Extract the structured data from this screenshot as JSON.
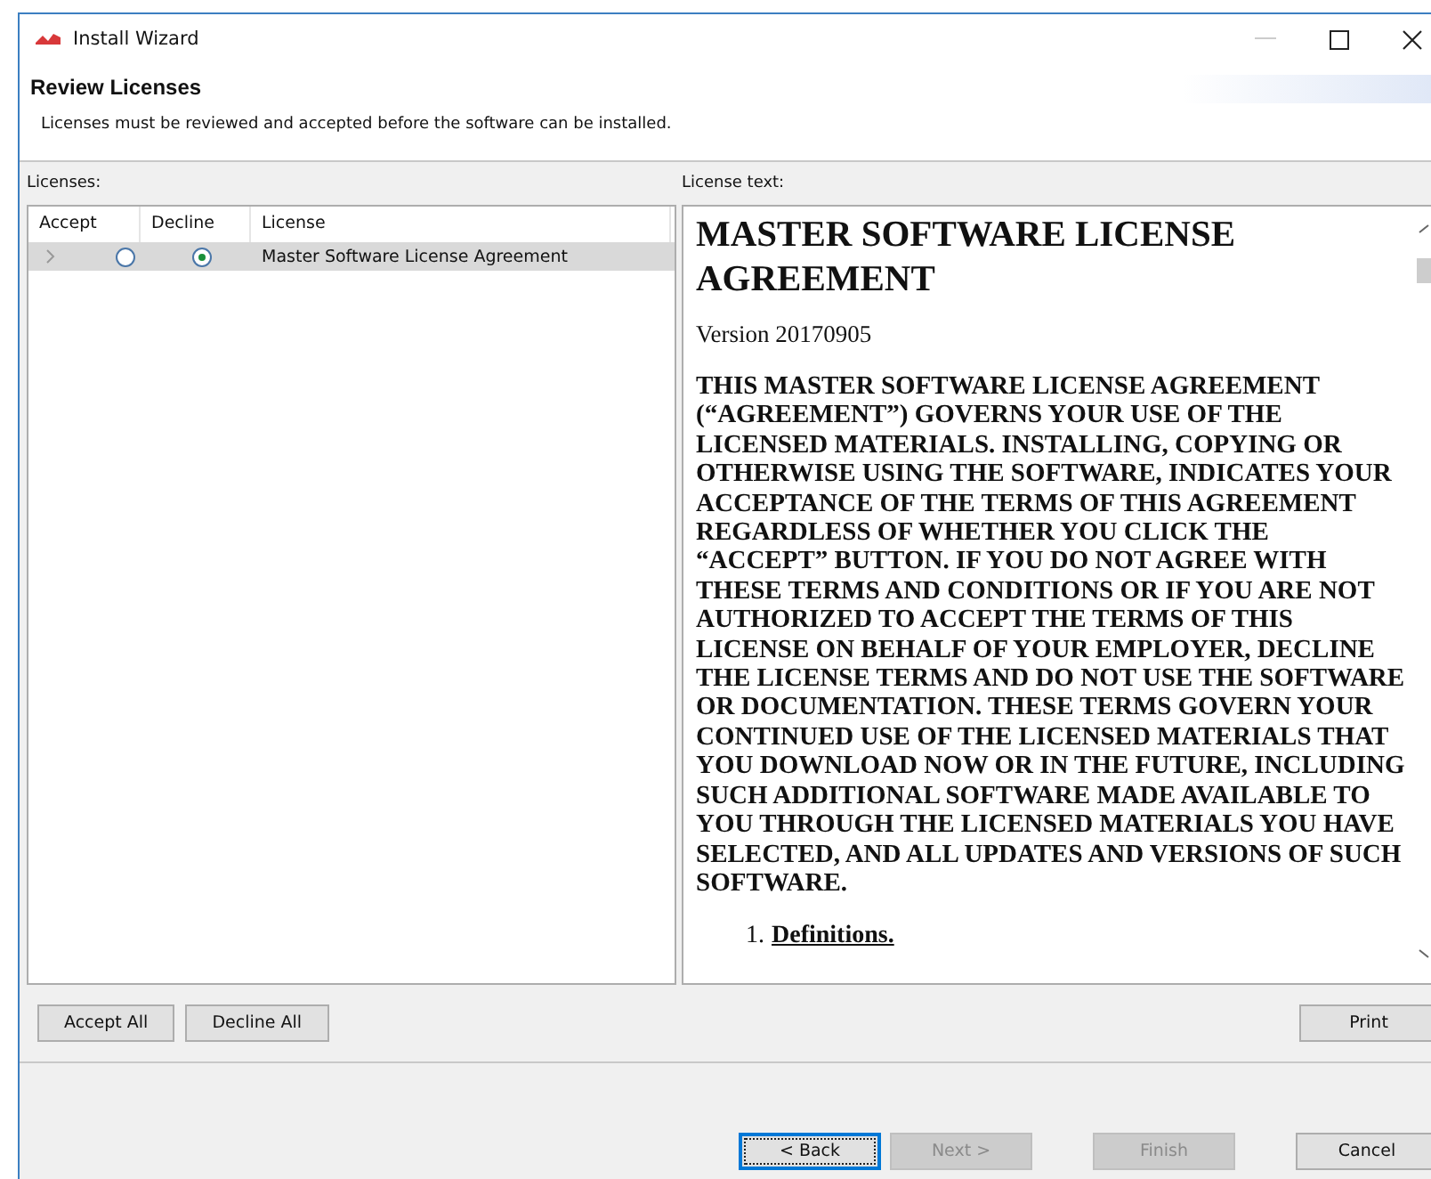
{
  "window": {
    "title": "Install Wizard"
  },
  "header": {
    "title": "Review Licenses",
    "description": "Licenses must be reviewed and accepted before the software can be installed."
  },
  "licenses": {
    "label": "Licenses:",
    "columns": [
      "Accept",
      "Decline",
      "License"
    ],
    "rows": [
      {
        "name": "Master Software License Agreement",
        "accepted": false,
        "declined": true,
        "selected": true,
        "expanded": false
      }
    ]
  },
  "license_text": {
    "label": "License text:",
    "title": "MASTER SOFTWARE LICENSE AGREEMENT",
    "version": "Version 20170905",
    "body": "THIS MASTER SOFTWARE LICENSE AGREEMENT (“AGREEMENT”) GOVERNS YOUR USE OF THE LICENSED MATERIALS. INSTALLING, COPYING OR OTHERWISE USING THE SOFTWARE, INDICATES YOUR ACCEPTANCE OF THE TERMS OF THIS AGREEMENT REGARDLESS OF WHETHER YOU CLICK THE “ACCEPT” BUTTON. IF YOU DO NOT AGREE WITH THESE TERMS AND CONDITIONS OR IF YOU ARE NOT AUTHORIZED TO ACCEPT THE TERMS OF THIS LICENSE ON BEHALF OF YOUR EMPLOYER, DECLINE THE LICENSE TERMS AND DO NOT USE THE SOFTWARE OR DOCUMENTATION. THESE TERMS GOVERN YOUR CONTINUED USE OF THE LICENSED MATERIALS THAT YOU DOWNLOAD NOW OR IN THE FUTURE, INCLUDING SUCH ADDITIONAL SOFTWARE MADE AVAILABLE TO YOU THROUGH THE LICENSED MATERIALS YOU HAVE SELECTED, AND ALL UPDATES AND VERSIONS OF SUCH SOFTWARE.",
    "sections": [
      {
        "number": "1.",
        "title": "Definitions."
      }
    ]
  },
  "list_buttons": [
    "Accept All",
    "Decline All"
  ],
  "print_button": "Print",
  "nav_buttons": [
    {
      "label": "< Back",
      "disabled": false,
      "focused": true
    },
    {
      "label": "Next >",
      "disabled": true,
      "focused": false
    },
    {
      "label": "Finish",
      "disabled": true,
      "focused": false
    },
    {
      "label": "Cancel",
      "disabled": false,
      "focused": false
    }
  ]
}
